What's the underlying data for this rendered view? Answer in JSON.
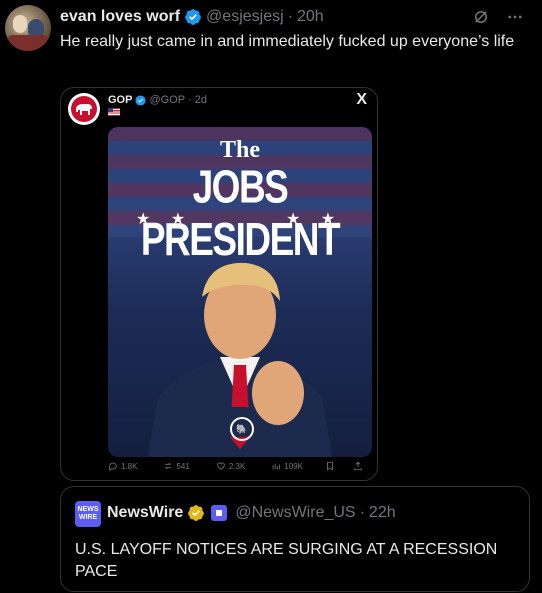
{
  "tweet": {
    "author_name": "evan loves worf",
    "handle": "@esjesjesj",
    "separator": "·",
    "time": "20h",
    "text": "He really just came in and immediately fucked up everyone’s life"
  },
  "embedded_post": {
    "author_name": "GOP",
    "handle": "@GOP",
    "separator": "·",
    "time": "2d",
    "logo_label": "X",
    "poster": {
      "line1": "The",
      "line2": "JOBS PRESIDENT",
      "stars_left": "★ ★",
      "stars_right": "★ ★"
    },
    "stats": {
      "replies": "1.8K",
      "reposts": "541",
      "likes": "2.3K",
      "views": "109K"
    }
  },
  "quoted_post": {
    "logo_text": "NEWS WIRE",
    "author_name": "NewsWire",
    "handle": "@NewsWire_US",
    "separator": "·",
    "time": "22h",
    "text": "U.S. LAYOFF NOTICES ARE SURGING AT A RECESSION PACE"
  },
  "icons": {
    "verified_blue": "#1d9bf0",
    "verified_gold": "#e2b719",
    "gop_red": "#c8102e",
    "newswire_purple": "#5b5ef0"
  }
}
